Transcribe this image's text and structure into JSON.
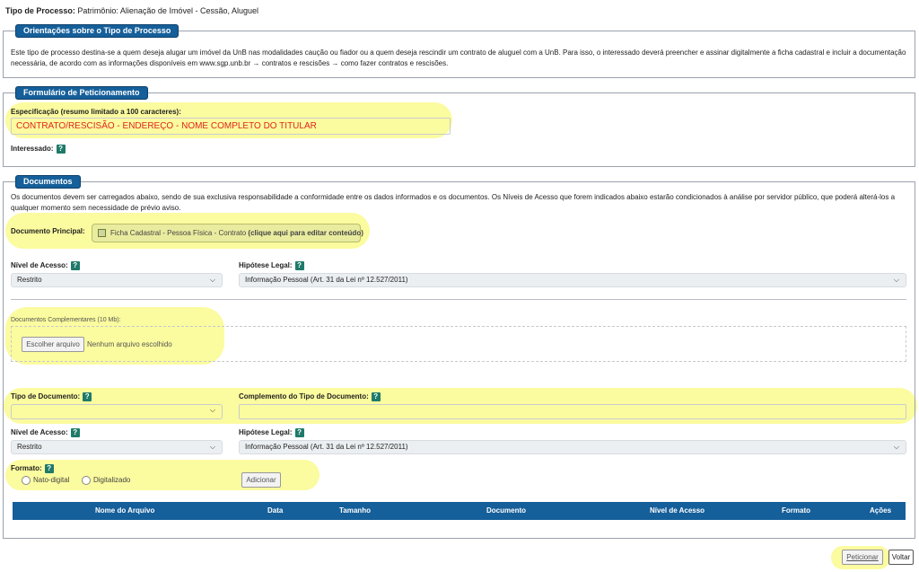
{
  "header": {
    "label": "Tipo de Processo:",
    "value": "Patrimônio: Alienação de Imóvel - Cessão, Aluguel"
  },
  "orientacoes": {
    "legend": "Orientações sobre o Tipo de Processo",
    "text": "Este tipo de processo destina-se a quem deseja alugar um imóvel da UnB nas modalidades caução ou fiador ou a quem deseja rescindir um contrato de aluguel com a UnB. Para isso, o interessado deverá preencher e assinar digitalmente a ficha cadastral e incluir a documentação necessária, de acordo com as informações disponíveis em www.sgp.unb.br → contratos e rescisões → como fazer contratos e rescisões."
  },
  "formulario": {
    "legend": "Formulário de Peticionamento",
    "especificacao_label": "Especificação (resumo limitado a 100 caracteres):",
    "especificacao_value": "CONTRATO/RESCISÃO - ENDEREÇO - NOME COMPLETO DO TITULAR",
    "interessado_label": "Interessado:"
  },
  "documentos": {
    "legend": "Documentos",
    "intro": "Os documentos devem ser carregados abaixo, sendo de sua exclusiva responsabilidade a conformidade entre os dados informados e os documentos. Os Níveis de Acesso que forem indicados abaixo estarão condicionados à análise por servidor público, que poderá alterá-los a qualquer momento sem necessidade de prévio aviso.",
    "principal_label": "Documento Principal:",
    "principal_button": "Ficha Cadastral - Pessoa Física - Contrato",
    "principal_hint": "(clique aqui para editar conteúdo)",
    "nivel_label": "Nível de Acesso:",
    "nivel_value": "Restrito",
    "hipotese_label": "Hipótese Legal:",
    "hipotese_value": "Informação Pessoal (Art. 31 da Lei nº 12.527/2011)",
    "complementares_label": "Documentos Complementares (10 Mb):",
    "escolher_button": "Escolher arquivo",
    "nenhum_arquivo": "Nenhum arquivo escolhido",
    "tipo_label": "Tipo de Documento:",
    "complemento_label": "Complemento do Tipo de Documento:",
    "nivel2_label": "Nível de Acesso:",
    "nivel2_value": "Restrito",
    "hipotese2_label": "Hipótese Legal:",
    "hipotese2_value": "Informação Pessoal (Art. 31 da Lei nº 12.527/2011)",
    "formato_label": "Formato:",
    "nato_digital": "Nato-digital",
    "digitalizado": "Digitalizado",
    "adicionar_button": "Adicionar",
    "table_headers": [
      "Nome do Arquivo",
      "Data",
      "Tamanho",
      "Documento",
      "Nível de Acesso",
      "Formato",
      "Ações"
    ]
  },
  "footer": {
    "peticionar": "Peticionar",
    "voltar": "Voltar"
  },
  "colors": {
    "legend_bg": "#155f9a",
    "highlight": "#fbfb9a",
    "help_icon": "#1f7a6a",
    "spec_text": "#e0261c"
  }
}
